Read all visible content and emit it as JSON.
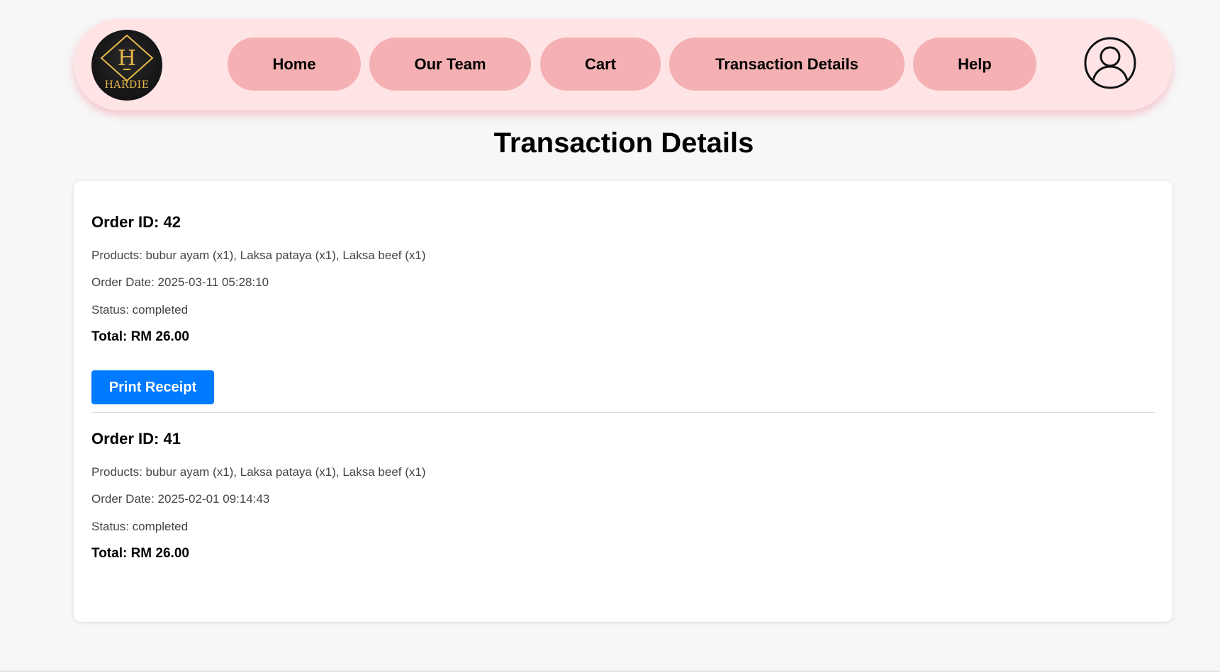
{
  "nav": {
    "logo_text": "HARDIE",
    "logo_letter": "H",
    "items": [
      {
        "label": "Home"
      },
      {
        "label": "Our Team"
      },
      {
        "label": "Cart"
      },
      {
        "label": "Transaction Details"
      },
      {
        "label": "Help"
      }
    ],
    "profile_icon": "user-circle-icon"
  },
  "page": {
    "title": "Transaction Details"
  },
  "orders": [
    {
      "id_label": "Order ID: 42",
      "products": "Products: bubur ayam (x1), Laksa pataya (x1), Laksa beef (x1)",
      "date": "Order Date: 2025-03-11 05:28:10",
      "status": "Status: completed",
      "total": "Total: RM 26.00",
      "button_label": "Print Receipt"
    },
    {
      "id_label": "Order ID: 41",
      "products": "Products: bubur ayam (x1), Laksa pataya (x1), Laksa beef (x1)",
      "date": "Order Date: 2025-02-01 09:14:43",
      "status": "Status: completed",
      "total": "Total: RM 26.00"
    }
  ],
  "colors": {
    "navbar_bg": "#ffe4e6",
    "nav_button": "#f4b0b2",
    "primary_button": "#007bff",
    "logo_gold": "#e8b84a"
  }
}
